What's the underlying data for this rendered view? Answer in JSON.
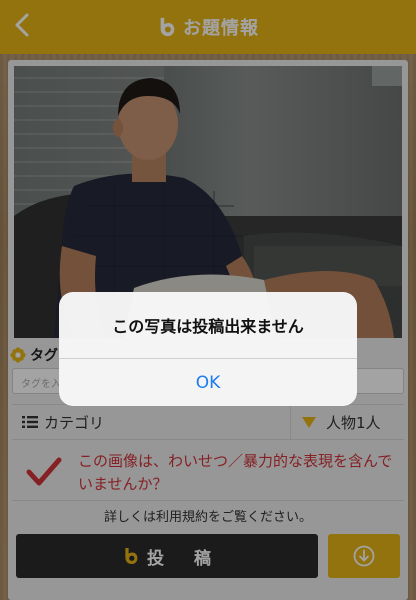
{
  "header": {
    "title": "お題情報",
    "back_icon": "chevron-left-icon",
    "logo_icon": "b-logo-icon",
    "bg_color": "#e6b417"
  },
  "form": {
    "tag_label": "タグ",
    "tag_icon": "gear-flower-icon",
    "tag_placeholder": "タグを入",
    "category_label": "カテゴリ",
    "category_icon": "list-icon",
    "category_value": "人物1人",
    "category_value_icon": "triangle-down-icon",
    "warning_text": "この画像は、わいせつ／暴力的な表現を含んでいませんか？",
    "warning_icon": "checkmark-icon",
    "terms_text": "詳しくは利用規約をご覧ください。",
    "post_label": "投 稿",
    "download_icon": "download-circle-icon"
  },
  "alert": {
    "message": "この写真は投稿出来ません",
    "ok_label": "OK"
  },
  "colors": {
    "accent": "#e6b417",
    "warning": "#d0343a",
    "link": "#1a7cf0",
    "dark_button": "#2b2b2b"
  }
}
